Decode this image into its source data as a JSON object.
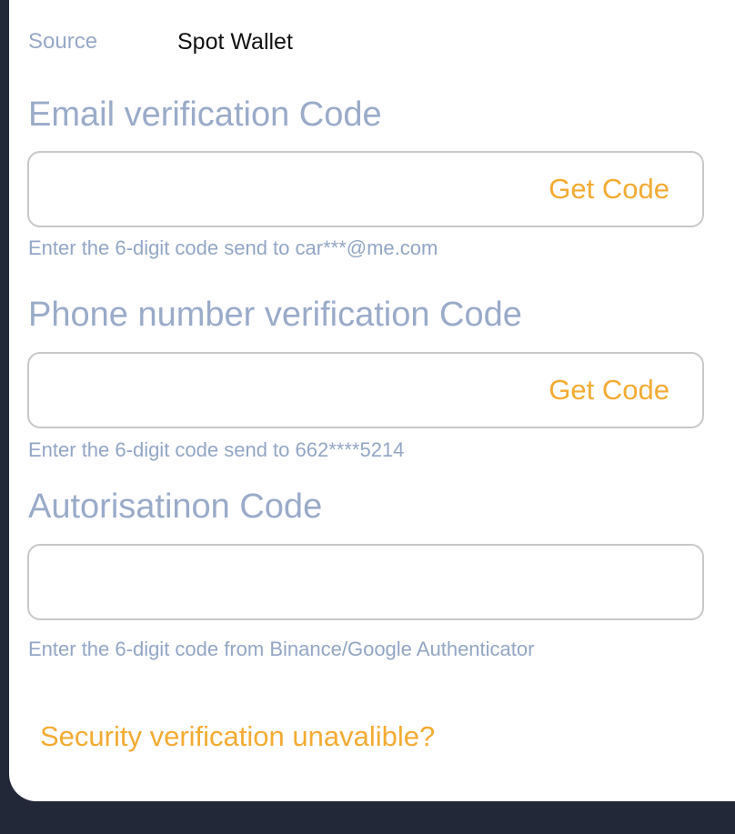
{
  "source": {
    "label": "Source",
    "value": "Spot Wallet"
  },
  "email": {
    "title": "Email verification Code",
    "input_value": "",
    "get_code_label": "Get Code",
    "hint": "Enter the 6-digit code send to car***@me.com"
  },
  "phone": {
    "title": "Phone number verification Code",
    "input_value": "",
    "get_code_label": "Get Code",
    "hint": "Enter the 6-digit code send to 662****5214"
  },
  "authenticator": {
    "title": "Autorisatinon Code",
    "input_value": "",
    "hint": "Enter the 6-digit code from Binance/Google Authenticator"
  },
  "security_link": "Security verification unavalible?",
  "colors": {
    "accent": "#f3ab33",
    "muted_text": "#9aabc9",
    "border": "#c8c8c8",
    "background_dark": "#232838"
  }
}
